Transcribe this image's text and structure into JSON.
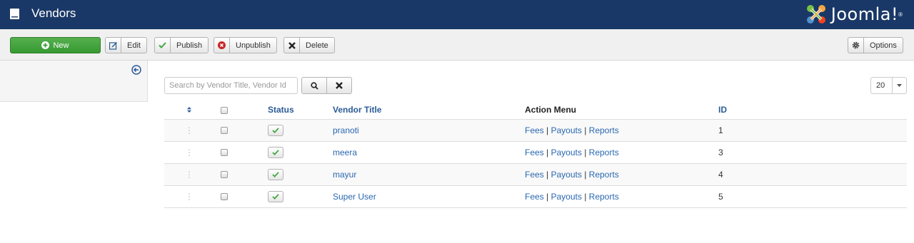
{
  "header": {
    "title": "Vendors",
    "brand": "Joomla!",
    "brand_mark": "®"
  },
  "toolbar": {
    "new_label": "New",
    "edit_label": "Edit",
    "publish_label": "Publish",
    "unpublish_label": "Unpublish",
    "delete_label": "Delete",
    "options_label": "Options"
  },
  "filter": {
    "search_placeholder": "Search by Vendor Title, Vendor Id",
    "limit_value": "20"
  },
  "table": {
    "headers": {
      "status": "Status",
      "vendor_title": "Vendor Title",
      "action_menu": "Action Menu",
      "id": "ID"
    },
    "rows": [
      {
        "title": "pranoti",
        "fees": "Fees",
        "payouts": "Payouts",
        "reports": "Reports",
        "id": "1"
      },
      {
        "title": "meera",
        "fees": "Fees",
        "payouts": "Payouts",
        "reports": "Reports",
        "id": "3"
      },
      {
        "title": "mayur",
        "fees": "Fees",
        "payouts": "Payouts",
        "reports": "Reports",
        "id": "4"
      },
      {
        "title": "Super User",
        "fees": "Fees",
        "payouts": "Payouts",
        "reports": "Reports",
        "id": "5"
      }
    ],
    "separator": "|",
    "drag_handle": "⋮"
  },
  "colors": {
    "header_bg": "#1a3867",
    "new_button": "#46a546",
    "link": "#2a68b0",
    "publish_check": "#46a546",
    "unpublish_icon": "#c52827"
  },
  "icons": {
    "page": "book-icon",
    "new": "plus-circle-icon",
    "edit": "edit-icon",
    "publish": "check-icon",
    "unpublish": "x-circle-icon",
    "delete": "x-icon",
    "options": "gear-icon",
    "sidebar_toggle": "arrow-left-circle-icon",
    "search": "search-icon",
    "clear": "x-icon",
    "sort": "sort-icon"
  }
}
